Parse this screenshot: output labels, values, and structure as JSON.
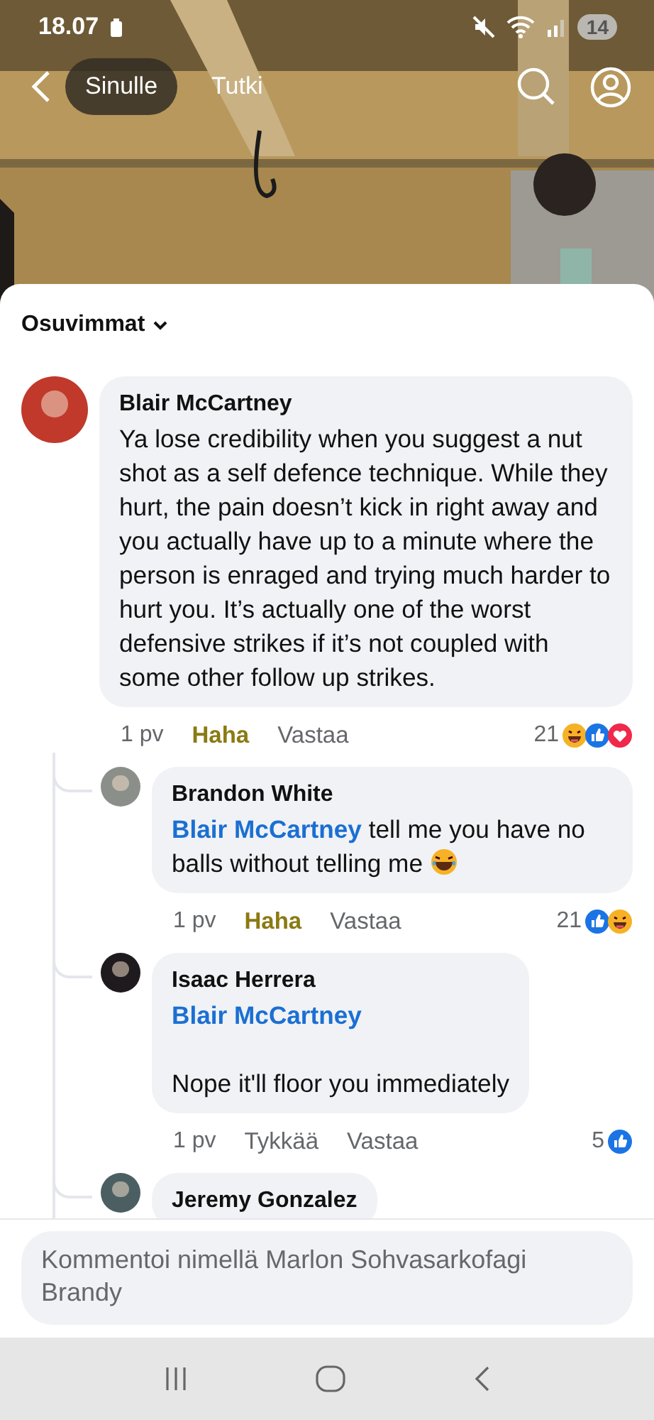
{
  "status_bar": {
    "time": "18.07",
    "notification_count": "14"
  },
  "top_nav": {
    "tabs": [
      {
        "label": "Sinulle",
        "selected": true
      },
      {
        "label": "Tutki",
        "selected": false
      }
    ]
  },
  "sort": {
    "label": "Osuvimmat"
  },
  "comments": [
    {
      "author": "Blair McCartney",
      "text": "Ya lose credibility when you suggest a nut shot as a self defence technique. While they hurt, the pain doesn’t kick in right away and you actually have up to a minute where the person is enraged and trying much harder to hurt you. It’s actually one of the worst defensive strikes if it’s not coupled with some other follow up strikes.",
      "time": "1 pv",
      "like_label": "Haha",
      "reacted": true,
      "reply_label": "Vastaa",
      "reaction_count": "21",
      "reactions": [
        {
          "kind": "haha"
        },
        {
          "kind": "like"
        },
        {
          "kind": "love"
        }
      ],
      "replies": [
        {
          "author": "Brandon White",
          "mention": "Blair McCartney",
          "text": "tell me you have no balls without telling me",
          "trailing_emoji": true,
          "time": "1 pv",
          "like_label": "Haha",
          "reacted": true,
          "reply_label": "Vastaa",
          "reaction_count": "21",
          "reactions": [
            {
              "kind": "like"
            },
            {
              "kind": "haha"
            }
          ]
        },
        {
          "author": "Isaac Herrera",
          "mention": "Blair McCartney",
          "text": "Nope it'll floor you immediately",
          "mention_break": true,
          "time": "1 pv",
          "like_label": "Tykkää",
          "reacted": false,
          "reply_label": "Vastaa",
          "reaction_count": "5",
          "reactions": [
            {
              "kind": "like"
            }
          ]
        },
        {
          "author": "Jeremy Gonzalez"
        }
      ]
    }
  ],
  "composer": {
    "placeholder": "Kommentoi nimellä Marlon Sohvasarkofagi Brandy"
  }
}
